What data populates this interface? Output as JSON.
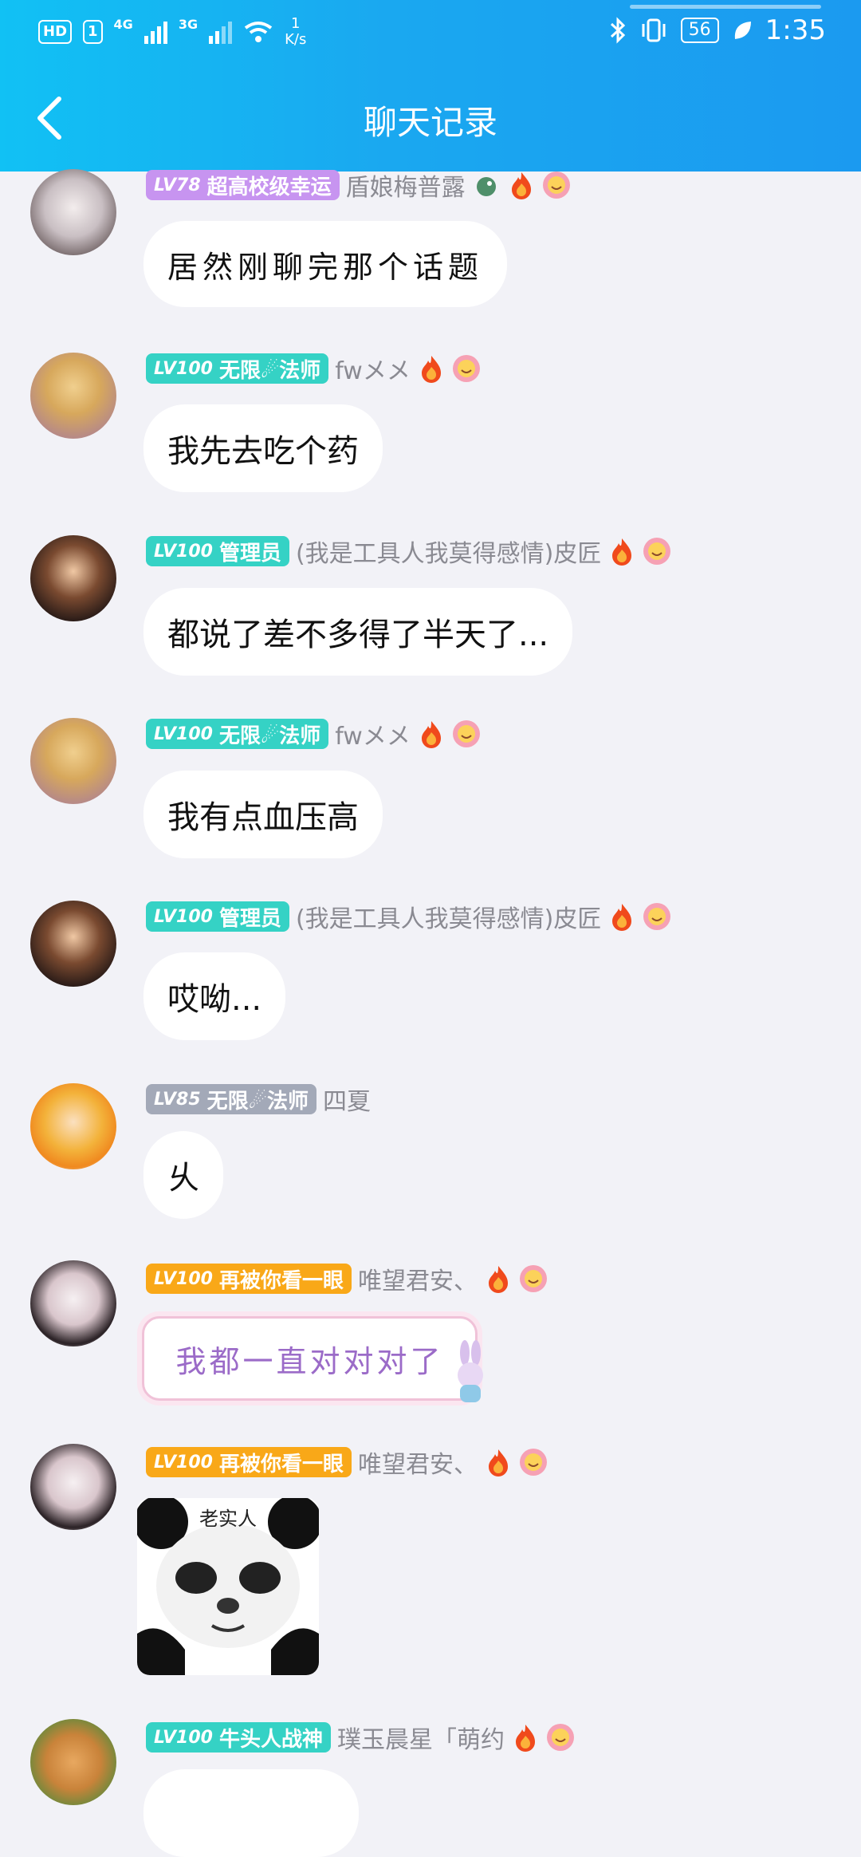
{
  "status_bar": {
    "hd": "HD",
    "sim": "1",
    "net1": "4G",
    "net2": "3G",
    "speed_value": "1",
    "speed_unit": "K/s",
    "battery": "56",
    "time": "1:35"
  },
  "nav": {
    "title": "聊天记录"
  },
  "messages": [
    {
      "level": "LV78",
      "title": "超高校级幸运",
      "name": "盾娘梅普露",
      "text": "居然刚聊完那个话题",
      "badge_color": "#c794f0"
    },
    {
      "level": "LV100",
      "title": "无限☄法师",
      "name": "fwメメ",
      "text": "我先去吃个药",
      "badge_color": "#35d2c5"
    },
    {
      "level": "LV100",
      "title": "管理员",
      "name": "(我是工具人我莫得感情)皮匠",
      "text": "都说了差不多得了半天了...",
      "badge_color": "#35d2c5"
    },
    {
      "level": "LV100",
      "title": "无限☄法师",
      "name": "fwメメ",
      "text": "我有点血压高",
      "badge_color": "#35d2c5"
    },
    {
      "level": "LV100",
      "title": "管理员",
      "name": "(我是工具人我莫得感情)皮匠",
      "text": "哎呦...",
      "badge_color": "#35d2c5"
    },
    {
      "level": "LV85",
      "title": "无限☄法师",
      "name": "四夏",
      "text": "乆",
      "badge_color": "#a3a9b8"
    },
    {
      "level": "LV100",
      "title": "再被你看一眼",
      "name": "唯望君安、",
      "text": "我都一直对对对了",
      "badge_color": "#f9a818"
    },
    {
      "level": "LV100",
      "title": "再被你看一眼",
      "name": "唯望君安、",
      "sticker_text": "老实人",
      "badge_color": "#f9a818"
    },
    {
      "level": "LV100",
      "title": "牛头人战神",
      "name": "璞玉晨星「萌约",
      "badge_color": "#35d2c5"
    }
  ]
}
